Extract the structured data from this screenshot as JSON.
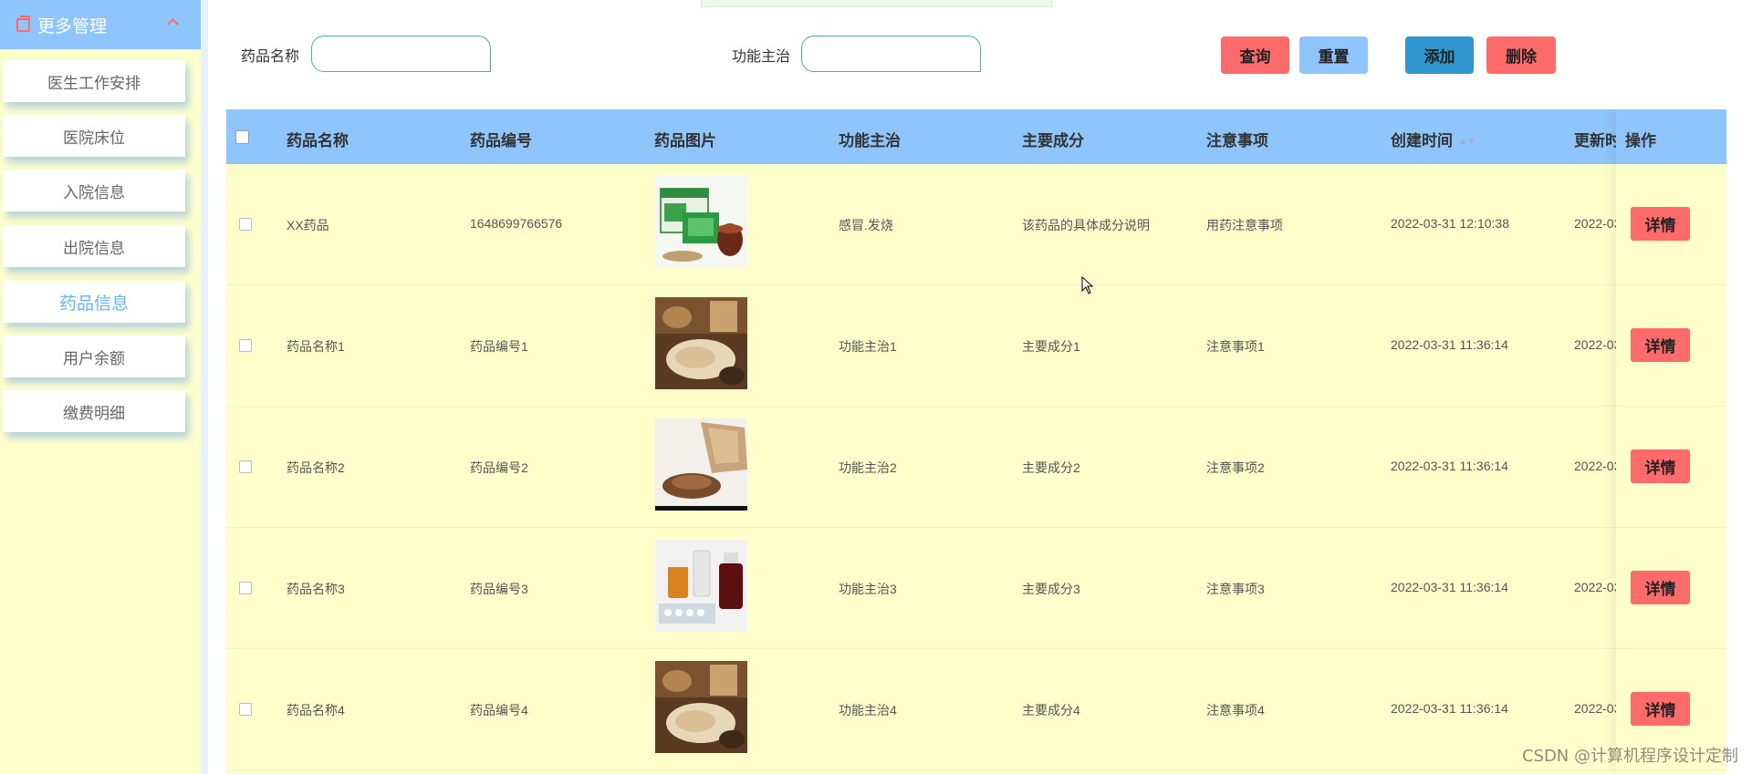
{
  "sidebar": {
    "header_label": "更多管理",
    "items": [
      {
        "label": "医生工作安排",
        "active": false
      },
      {
        "label": "医院床位",
        "active": false
      },
      {
        "label": "入院信息",
        "active": false
      },
      {
        "label": "出院信息",
        "active": false
      },
      {
        "label": "药品信息",
        "active": true
      },
      {
        "label": "用户余额",
        "active": false
      },
      {
        "label": "缴费明细",
        "active": false
      }
    ]
  },
  "search": {
    "name_label": "药品名称",
    "name_value": "",
    "function_label": "功能主治",
    "function_value": ""
  },
  "toolbar": {
    "query_label": "查询",
    "reset_label": "重置",
    "add_label": "添加",
    "delete_label": "删除"
  },
  "table": {
    "columns": [
      "药品名称",
      "药品编号",
      "药品图片",
      "功能主治",
      "主要成分",
      "注意事项",
      "创建时间",
      "更新时间"
    ],
    "action_header": "操作",
    "detail_label": "详情",
    "rows": [
      {
        "name": "XX药品",
        "code": "1648699766576",
        "image": "medicine-box-photo",
        "function": "感冒.发烧",
        "ingredients": "该药品的具体成分说明",
        "notes": "用药注意事项",
        "created": "2022-03-31 12:10:38",
        "updated": "2022-03"
      },
      {
        "name": "药品名称1",
        "code": "药品编号1",
        "image": "herbal-medicine-photo",
        "function": "功能主治1",
        "ingredients": "主要成分1",
        "notes": "注意事项1",
        "created": "2022-03-31 11:36:14",
        "updated": "2022-03"
      },
      {
        "name": "药品名称2",
        "code": "药品编号2",
        "image": "herb-bag-photo",
        "function": "功能主治2",
        "ingredients": "主要成分2",
        "notes": "注意事项2",
        "created": "2022-03-31 11:36:14",
        "updated": "2022-03"
      },
      {
        "name": "药品名称3",
        "code": "药品编号3",
        "image": "pill-bottles-photo",
        "function": "功能主治3",
        "ingredients": "主要成分3",
        "notes": "注意事项3",
        "created": "2022-03-31 11:36:14",
        "updated": "2022-03"
      },
      {
        "name": "药品名称4",
        "code": "药品编号4",
        "image": "herbal-medicine-photo",
        "function": "功能主治4",
        "ingredients": "主要成分4",
        "notes": "注意事项4",
        "created": "2022-03-31 11:36:14",
        "updated": "2022-03"
      }
    ]
  },
  "watermark": "CSDN @计算机程序设计定制",
  "colors": {
    "sidebar_bg": "#ffffcc",
    "header_blue": "#8ec5fc",
    "danger": "#ff6b6b",
    "primary": "#2f96d0",
    "active_text": "#64b4f6"
  }
}
